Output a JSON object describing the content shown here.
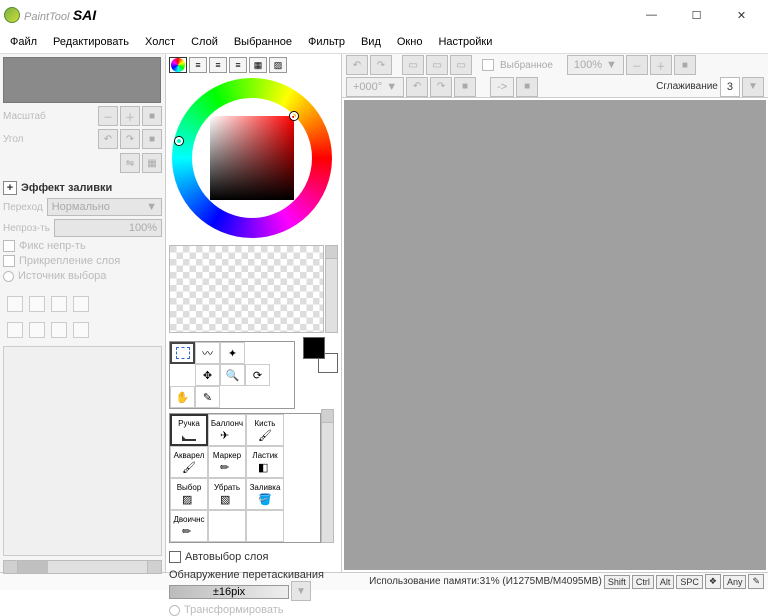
{
  "app": {
    "title_prefix": "PaintTool",
    "title_suffix": "SAI"
  },
  "menu": [
    "Файл",
    "Редактировать",
    "Холст",
    "Слой",
    "Выбранное",
    "Фильтр",
    "Вид",
    "Окно",
    "Настройки"
  ],
  "left": {
    "scale_label": "Масштаб",
    "angle_label": "Угол",
    "fill_effect": "Эффект заливки",
    "blend_label": "Переход",
    "blend_value": "Нормально",
    "opacity_label": "Непроз-ть",
    "opacity_value": "100%",
    "fix_opacity": "Фикс непр-ть",
    "attach_layer": "Прикрепление слоя",
    "selection_source": "Источник выбора"
  },
  "mid": {
    "autoselect": "Автовыбор слоя",
    "drag_detect": "Обнаружение перетаскивания",
    "drag_value": "±16pix",
    "transform": "Трансформировать",
    "brushes": [
      "Ручка",
      "Баллонч",
      "Кисть",
      "Акварел",
      "Маркер",
      "Ластик",
      "Выбор",
      "Убрать",
      "Заливка",
      "Двоичнс"
    ]
  },
  "top": {
    "selection": "Выбранное",
    "zoom": "100%",
    "angle": "+000°",
    "arrow": "->",
    "aa_label": "Сглаживание",
    "aa_value": "3"
  },
  "status": {
    "memory": "Использование памяти:31% (И1275MB/M4095MB)",
    "keys": [
      "Shift",
      "Ctrl",
      "Alt",
      "SPC",
      "❖",
      "Any",
      "✎"
    ]
  }
}
